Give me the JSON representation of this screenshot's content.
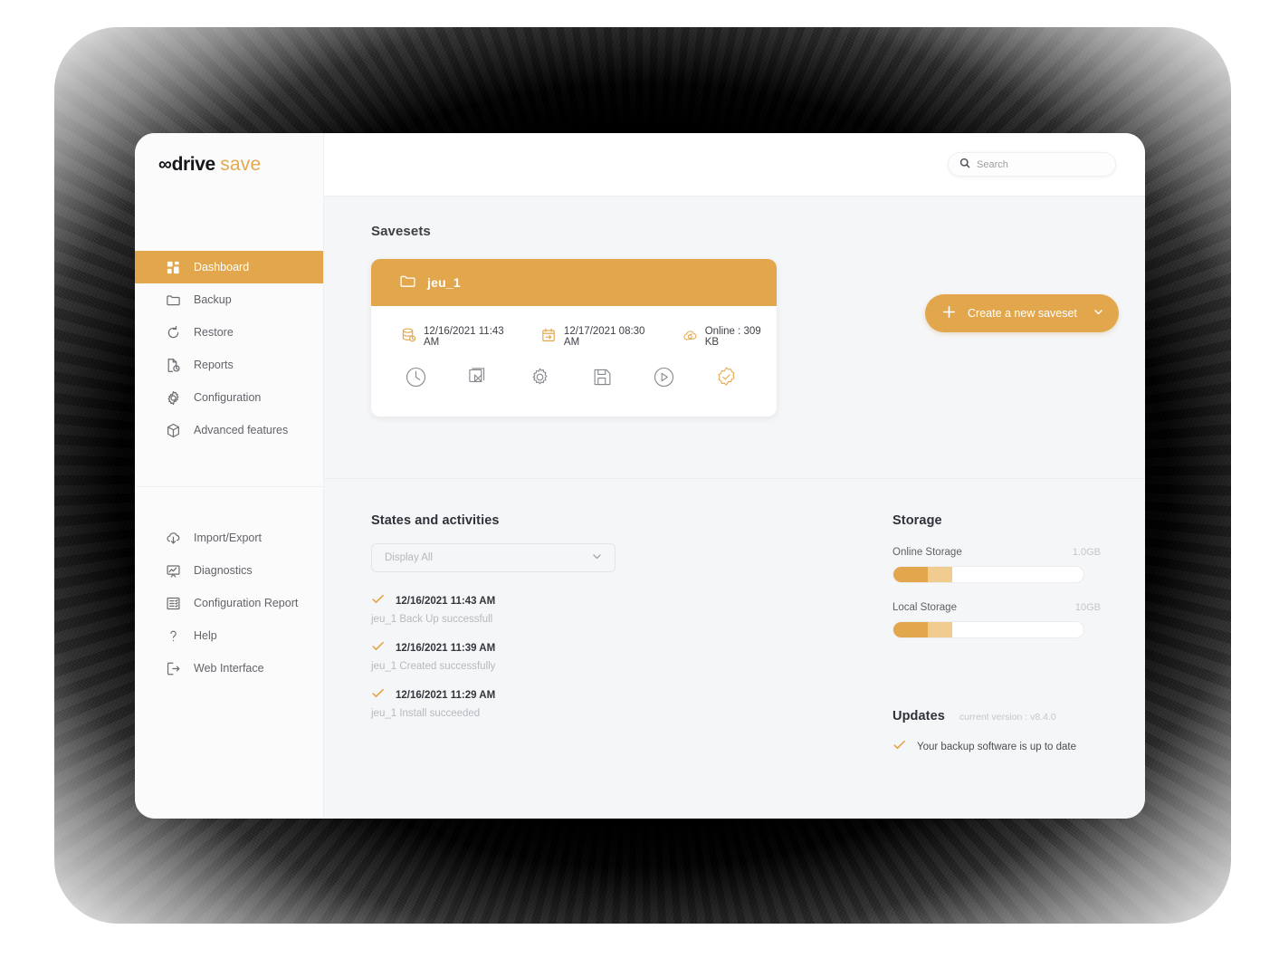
{
  "brand": {
    "name_dark": "∞drive",
    "name_accent": "save",
    "accent_color": "#e2a74c"
  },
  "sidebar": {
    "primary_items": [
      {
        "label": "Dashboard",
        "icon": "dashboard-grid-icon",
        "active": true
      },
      {
        "label": "Backup",
        "icon": "folder-icon",
        "active": false
      },
      {
        "label": "Restore",
        "icon": "restore-circular-arrow-icon",
        "active": false
      },
      {
        "label": "Reports",
        "icon": "document-clock-icon",
        "active": false
      },
      {
        "label": "Configuration",
        "icon": "gear-icon",
        "active": false
      },
      {
        "label": "Advanced features",
        "icon": "cube-icon",
        "active": false
      }
    ],
    "secondary_items": [
      {
        "label": "Import/Export",
        "icon": "cloud-upload-icon"
      },
      {
        "label": "Diagnostics",
        "icon": "chart-frame-icon"
      },
      {
        "label": "Configuration Report",
        "icon": "list-report-icon"
      },
      {
        "label": "Help",
        "icon": "question-mark-icon"
      },
      {
        "label": "Web Interface",
        "icon": "exit-arrow-icon"
      }
    ]
  },
  "topbar": {
    "search_placeholder": "Search",
    "search_value": "",
    "search_icon": "search-icon"
  },
  "savesets": {
    "title": "Savesets",
    "create_button": {
      "label": "Create a new saveset",
      "plus_icon": "plus-icon",
      "caret_icon": "chevron-down-icon"
    },
    "card": {
      "name": "jeu_1",
      "folder_icon": "folder-icon",
      "info": [
        {
          "icon": "database-icon",
          "text": "12/16/2021 11:43 AM"
        },
        {
          "icon": "calendar-next-icon",
          "text": "12/17/2021 08:30 AM"
        },
        {
          "icon": "cloud-sync-icon",
          "text": "Online : 309 KB"
        }
      ],
      "actions": [
        {
          "icon": "clock-icon",
          "accent": false
        },
        {
          "icon": "duplicate-icon",
          "accent": false
        },
        {
          "icon": "gear-icon",
          "accent": false
        },
        {
          "icon": "floppy-save-icon",
          "accent": false
        },
        {
          "icon": "play-circle-icon",
          "accent": false
        },
        {
          "icon": "verified-check-badge-icon",
          "accent": true
        }
      ]
    }
  },
  "states": {
    "title": "States and activities",
    "filter": {
      "value": "Display All",
      "caret_icon": "chevron-down-icon"
    },
    "items": [
      {
        "icon": "check-icon",
        "timestamp": "12/16/2021 11:43 AM",
        "description": "jeu_1 Back Up successfull"
      },
      {
        "icon": "check-icon",
        "timestamp": "12/16/2021 11:39 AM",
        "description": "jeu_1 Created successfully"
      },
      {
        "icon": "check-icon",
        "timestamp": "12/16/2021 11:29 AM",
        "description": "jeu_1 Install succeeded"
      }
    ]
  },
  "storage": {
    "title": "Storage",
    "bars": [
      {
        "label": "Online Storage",
        "size": "1.0GB",
        "used_pct": 18,
        "reserved_pct": 13
      },
      {
        "label": "Local Storage",
        "size": "10GB",
        "used_pct": 18,
        "reserved_pct": 13
      }
    ]
  },
  "updates": {
    "title": "Updates",
    "version": "current version : v8.4.0",
    "status_icon": "check-icon",
    "status": "Your backup software is up to date"
  }
}
